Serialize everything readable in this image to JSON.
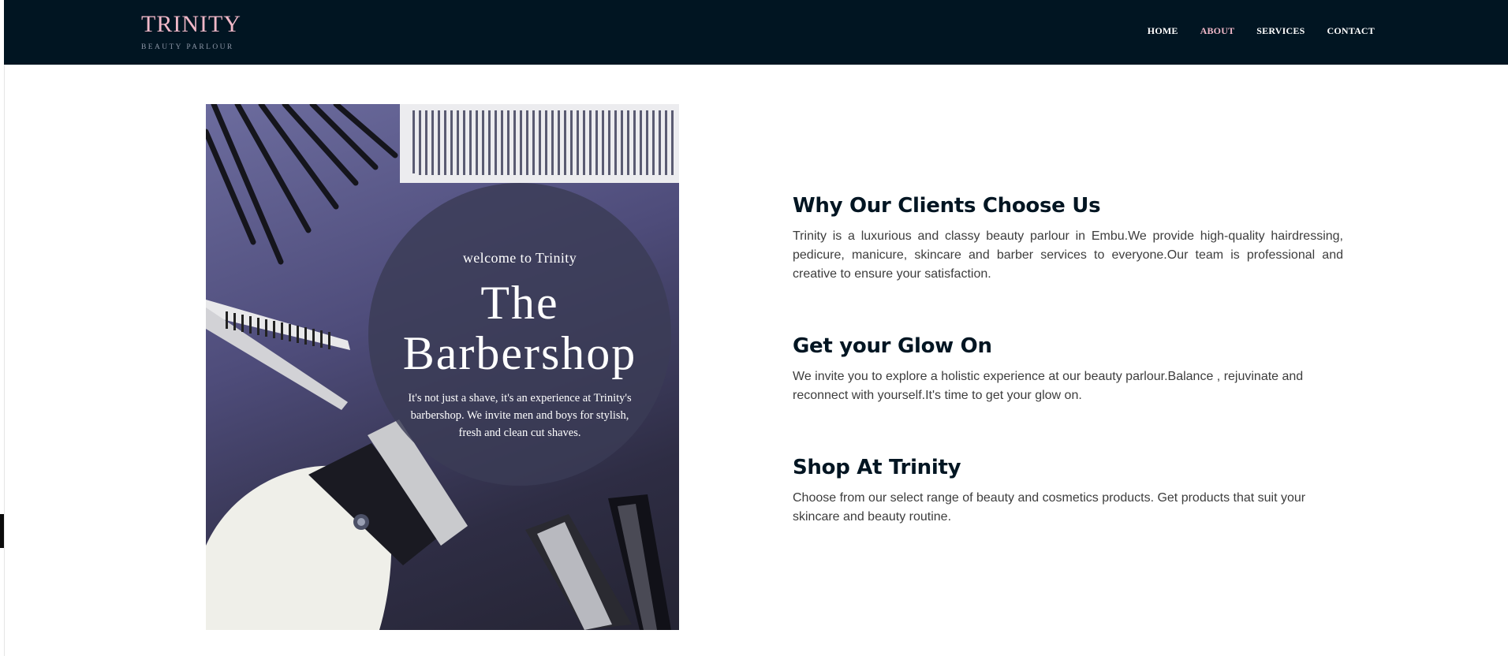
{
  "header": {
    "brand_name": "TRINITY",
    "brand_tagline": "BEAUTY PARLOUR",
    "nav": [
      {
        "label": "HOME",
        "active": false
      },
      {
        "label": "ABOUT",
        "active": true
      },
      {
        "label": "SERVICES",
        "active": false
      },
      {
        "label": "CONTACT",
        "active": false
      }
    ]
  },
  "poster": {
    "welcome": "welcome to Trinity",
    "title_line1": "The",
    "title_line2": "Barbershop",
    "subtitle": "It's not just a shave, it's an experience at Trinity's barbershop. We invite men and boys for stylish, fresh and clean cut shaves."
  },
  "sections": [
    {
      "heading": "Why Our Clients Choose Us",
      "text": "Trinity is a luxurious and classy beauty parlour in Embu.We provide high-quality hairdressing, pedicure, manicure, skincare and barber services to everyone.Our team is professional and creative to ensure your satisfaction."
    },
    {
      "heading": "Get your Glow On",
      "text": "We invite you to explore a holistic experience at our beauty parlour.Balance , rejuvinate and reconnect with yourself.It's time to get your glow on."
    },
    {
      "heading": "Shop At Trinity",
      "text": "Choose from our select range of beauty and cosmetics products. Get products that suit your skincare and beauty routine."
    }
  ],
  "colors": {
    "header_bg": "#011522",
    "brand_accent": "#f1b8c8",
    "heading": "#011522",
    "body_text": "#3d3d3d"
  }
}
